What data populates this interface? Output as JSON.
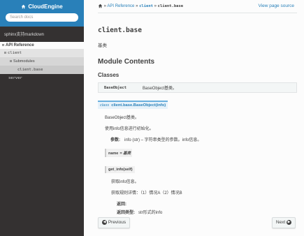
{
  "sidebar": {
    "brand": "CloudEngine",
    "search_placeholder": "Search docs",
    "items": [
      {
        "label": "sphinx支持markdown"
      },
      {
        "label": "API Reference",
        "toggle": "⊟"
      },
      {
        "label": "client",
        "toggle": "⊟"
      },
      {
        "label": "Submodules",
        "toggle": "⊟"
      },
      {
        "label": "client.base"
      },
      {
        "label": "server"
      }
    ]
  },
  "breadcrumb": {
    "sep": "»",
    "items": [
      "API Reference",
      "client",
      "client.base"
    ],
    "view_source": "View page source"
  },
  "main": {
    "title": "client.base",
    "intro": "基类",
    "h_module_contents": "Module Contents",
    "h_classes": "Classes",
    "class_table": [
      {
        "name": "BaseObject",
        "desc": "BaseObject基类。"
      }
    ],
    "signature": {
      "keyword": "class",
      "text": "client.base.BaseObject(info)"
    },
    "class_desc": "BaseObject基类。",
    "init_desc": "使用info信息进行初始化。",
    "params_label": "参数:",
    "params_text": "info (str) – 字符串类型的参数。info信息。",
    "field_name": "name",
    "field_value": "= 基类",
    "method_sig": "get_info(self)",
    "method_desc": "获取info信息。",
    "method_detail": "获取规则详情：（1）情况A（2）情况B",
    "returns_label": "返回:",
    "return_type_label": "返回类型:",
    "return_type_value": "str形式的info"
  },
  "footer": {
    "prev": "Previous",
    "next": "Next"
  }
}
